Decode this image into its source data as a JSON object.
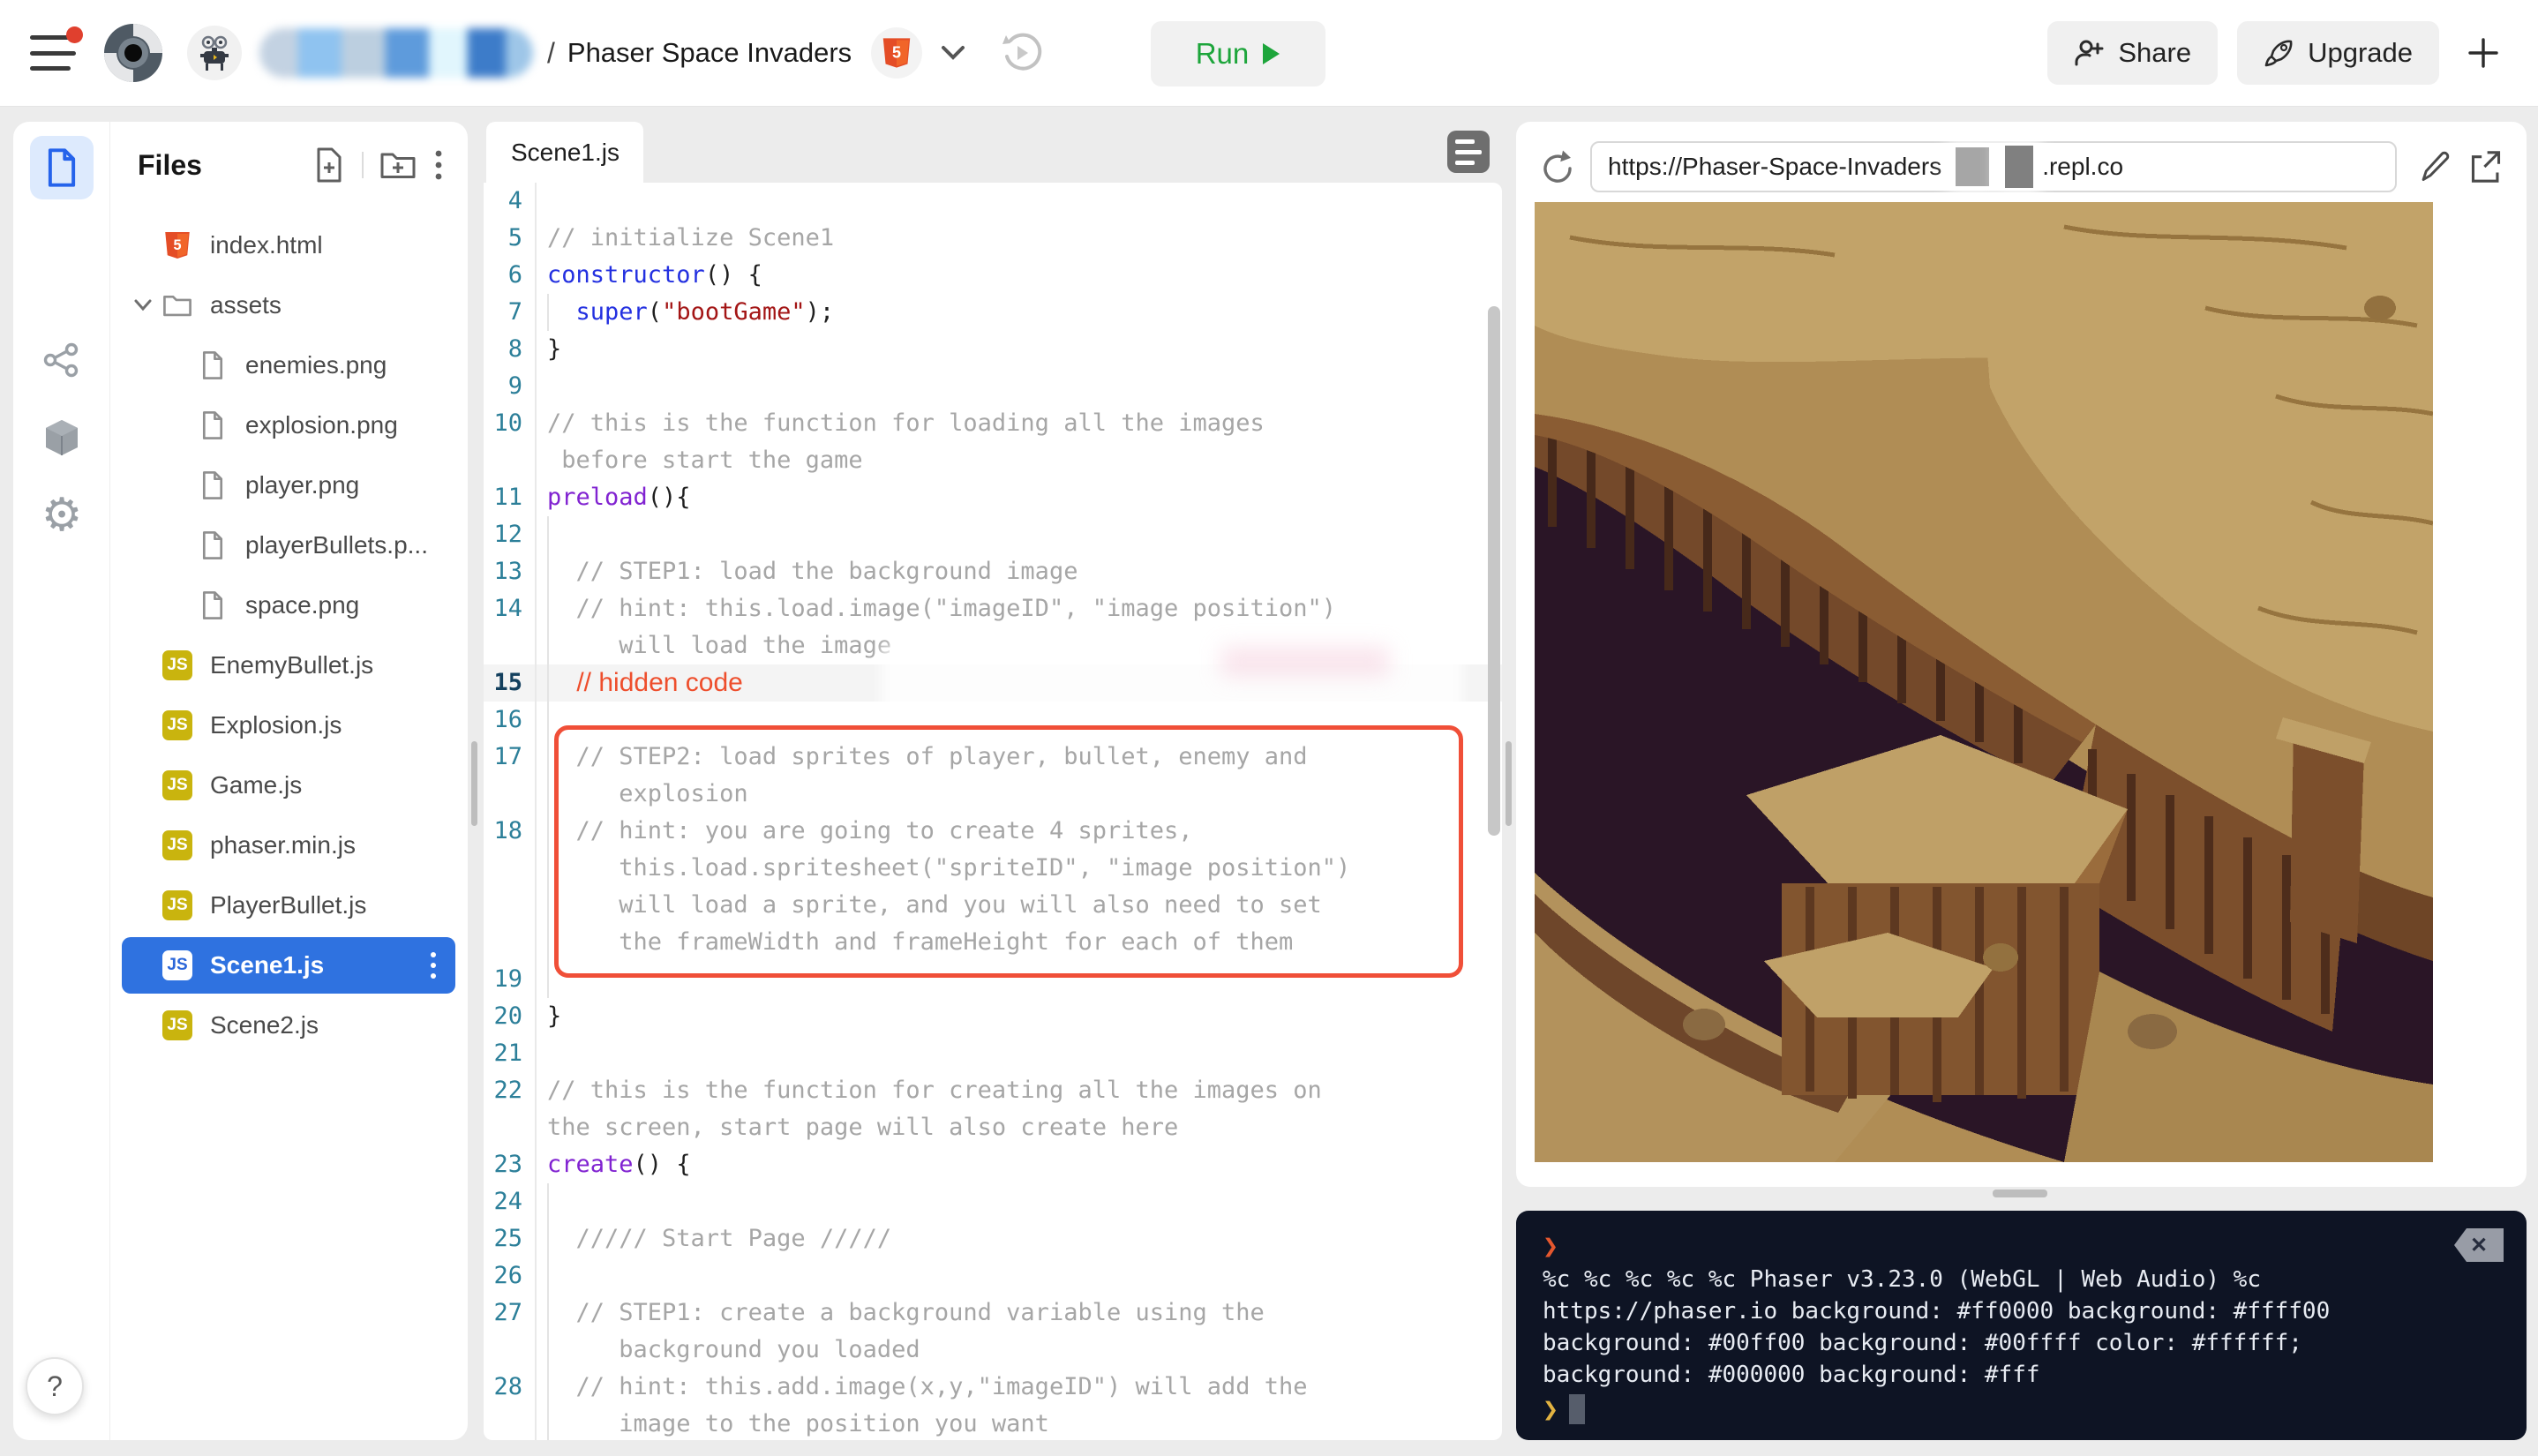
{
  "topbar": {
    "separator": "/",
    "project_name": "Phaser Space Invaders",
    "run_label": "Run",
    "share_label": "Share",
    "upgrade_label": "Upgrade",
    "plus_label": "+"
  },
  "rail": {
    "help_label": "?"
  },
  "files": {
    "title": "Files",
    "items": [
      {
        "label": "index.html",
        "icon": "html",
        "level": 1
      },
      {
        "label": "assets",
        "icon": "folder",
        "level": 1,
        "expanded": true
      },
      {
        "label": "enemies.png",
        "icon": "file",
        "level": 2
      },
      {
        "label": "explosion.png",
        "icon": "file",
        "level": 2
      },
      {
        "label": "player.png",
        "icon": "file",
        "level": 2
      },
      {
        "label": "playerBullets.p...",
        "icon": "file",
        "level": 2
      },
      {
        "label": "space.png",
        "icon": "file",
        "level": 2
      },
      {
        "label": "EnemyBullet.js",
        "icon": "js",
        "level": 1
      },
      {
        "label": "Explosion.js",
        "icon": "js",
        "level": 1
      },
      {
        "label": "Game.js",
        "icon": "js",
        "level": 1
      },
      {
        "label": "phaser.min.js",
        "icon": "js",
        "level": 1
      },
      {
        "label": "PlayerBullet.js",
        "icon": "js",
        "level": 1
      },
      {
        "label": "Scene1.js",
        "icon": "js",
        "level": 1,
        "selected": true
      },
      {
        "label": "Scene2.js",
        "icon": "js",
        "level": 1
      }
    ]
  },
  "editor": {
    "tab": "Scene1.js",
    "rows": [
      {
        "num": "4",
        "seg": []
      },
      {
        "num": "5",
        "seg": [
          [
            "c",
            "// initialize Scene1"
          ]
        ]
      },
      {
        "num": "6",
        "seg": [
          [
            "k",
            "constructor"
          ],
          [
            "p",
            "() {"
          ]
        ]
      },
      {
        "num": "7",
        "g": 1,
        "seg": [
          [
            "p",
            "  "
          ],
          [
            "k",
            "super"
          ],
          [
            "p",
            "("
          ],
          [
            "s",
            "\"bootGame\""
          ],
          [
            "p",
            ");"
          ]
        ]
      },
      {
        "num": "8",
        "seg": [
          [
            "p",
            "}"
          ]
        ]
      },
      {
        "num": "9",
        "seg": []
      },
      {
        "num": "10",
        "seg": [
          [
            "c",
            "// this is the function for loading all the images"
          ]
        ]
      },
      {
        "num": "",
        "seg": [
          [
            "c",
            " before start the game"
          ]
        ]
      },
      {
        "num": "11",
        "seg": [
          [
            "f",
            "preload"
          ],
          [
            "p",
            "(){"
          ]
        ]
      },
      {
        "num": "12",
        "g": 1,
        "seg": []
      },
      {
        "num": "13",
        "g": 1,
        "seg": [
          [
            "c",
            "  // STEP1: load the background image"
          ]
        ]
      },
      {
        "num": "14",
        "g": 1,
        "seg": [
          [
            "c",
            "  // hint: this.load.image(\"imageID\", \"image position\")"
          ]
        ]
      },
      {
        "num": "",
        "g": 1,
        "seg": [
          [
            "c",
            "     will load the image"
          ]
        ]
      },
      {
        "num": "15",
        "g": 1,
        "hl": 1,
        "cur": 1,
        "seg": [
          [
            "h",
            "    // hidden code"
          ]
        ]
      },
      {
        "num": "16",
        "g": 1,
        "seg": []
      },
      {
        "num": "17",
        "g": 1,
        "seg": [
          [
            "c",
            "  // STEP2: load sprites of player, bullet, enemy and"
          ]
        ]
      },
      {
        "num": "",
        "g": 1,
        "seg": [
          [
            "c",
            "     explosion"
          ]
        ]
      },
      {
        "num": "18",
        "g": 1,
        "seg": [
          [
            "c",
            "  // hint: you are going to create 4 sprites,"
          ]
        ]
      },
      {
        "num": "",
        "g": 1,
        "seg": [
          [
            "c",
            "     this.load.spritesheet(\"spriteID\", \"image position\")"
          ]
        ]
      },
      {
        "num": "",
        "g": 1,
        "seg": [
          [
            "c",
            "     will load a sprite, and you will also need to set"
          ]
        ]
      },
      {
        "num": "",
        "g": 1,
        "seg": [
          [
            "c",
            "     the frameWidth and frameHeight for each of them"
          ]
        ]
      },
      {
        "num": "19",
        "g": 1,
        "seg": []
      },
      {
        "num": "20",
        "seg": [
          [
            "p",
            "}"
          ]
        ]
      },
      {
        "num": "21",
        "seg": []
      },
      {
        "num": "22",
        "seg": [
          [
            "c",
            "// this is the function for creating all the images on"
          ]
        ]
      },
      {
        "num": "",
        "seg": [
          [
            "c",
            "the screen, start page will also create here"
          ]
        ]
      },
      {
        "num": "23",
        "seg": [
          [
            "f",
            "create"
          ],
          [
            "p",
            "() {"
          ]
        ]
      },
      {
        "num": "24",
        "g": 1,
        "seg": []
      },
      {
        "num": "25",
        "g": 1,
        "seg": [
          [
            "c",
            "  ///// Start Page /////"
          ]
        ]
      },
      {
        "num": "26",
        "g": 1,
        "seg": []
      },
      {
        "num": "27",
        "g": 1,
        "seg": [
          [
            "c",
            "  // STEP1: create a background variable using the"
          ]
        ]
      },
      {
        "num": "",
        "g": 1,
        "seg": [
          [
            "c",
            "     background you loaded"
          ]
        ]
      },
      {
        "num": "28",
        "g": 1,
        "seg": [
          [
            "c",
            "  // hint: this.add.image(x,y,\"imageID\") will add the"
          ]
        ]
      },
      {
        "num": "",
        "g": 1,
        "seg": [
          [
            "c",
            "     image to the position you want"
          ]
        ]
      }
    ]
  },
  "preview": {
    "url_prefix": "https://Phaser-Space-Invaders",
    "url_suffix": ".repl.co"
  },
  "console": {
    "prompt1": "❯",
    "prompt2": "❯",
    "close_label": "✕",
    "lines": [
      "%c %c %c %c %c Phaser v3.23.0 (WebGL | Web Audio) %c",
      "https://phaser.io background: #ff0000 background: #ffff00",
      "background: #00ff00 background: #00ffff color: #ffffff;",
      "background: #000000 background: #fff"
    ]
  },
  "colors": {
    "accent_blue": "#2f72e0",
    "run_green": "#1da53b",
    "annotation_red": "#ee4e2c",
    "js_badge_yellow": "#c9b40e",
    "console_bg": "#0e1424"
  }
}
